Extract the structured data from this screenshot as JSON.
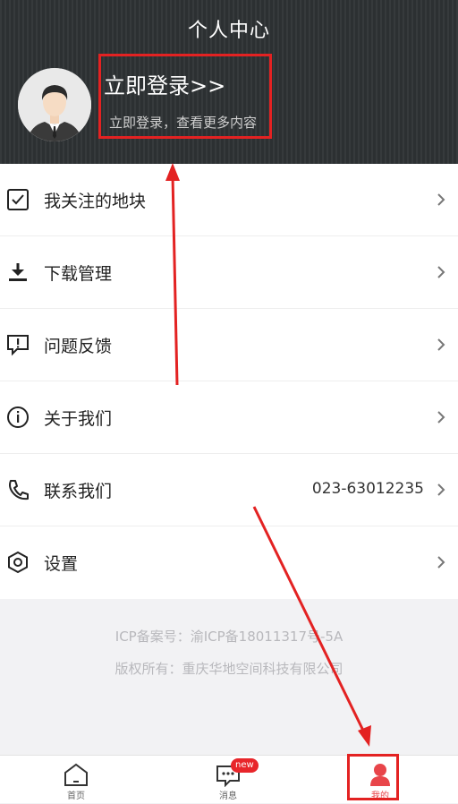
{
  "header": {
    "title": "个人中心",
    "login_title": "立即登录>>",
    "login_subtitle": "立即登录，查看更多内容"
  },
  "menu": {
    "items": [
      {
        "icon": "checkbox-icon",
        "label": "我关注的地块",
        "value": ""
      },
      {
        "icon": "download-icon",
        "label": "下载管理",
        "value": ""
      },
      {
        "icon": "feedback-icon",
        "label": "问题反馈",
        "value": ""
      },
      {
        "icon": "info-icon",
        "label": "关于我们",
        "value": ""
      },
      {
        "icon": "phone-icon",
        "label": "联系我们",
        "value": "023-63012235"
      },
      {
        "icon": "settings-icon",
        "label": "设置",
        "value": ""
      }
    ]
  },
  "footer": {
    "icp": "ICP备案号：渝ICP备18011317号-5A",
    "copyright": "版权所有：重庆华地空间科技有限公司"
  },
  "tabbar": {
    "tabs": [
      {
        "icon": "home-icon",
        "label": "首页"
      },
      {
        "icon": "message-icon",
        "label": "消息",
        "badge": "new"
      },
      {
        "icon": "profile-icon",
        "label": "我的",
        "active": true
      }
    ]
  },
  "colors": {
    "accent": "#e8454a",
    "annotation": "#e32222",
    "header_bg": "#2f3335"
  }
}
